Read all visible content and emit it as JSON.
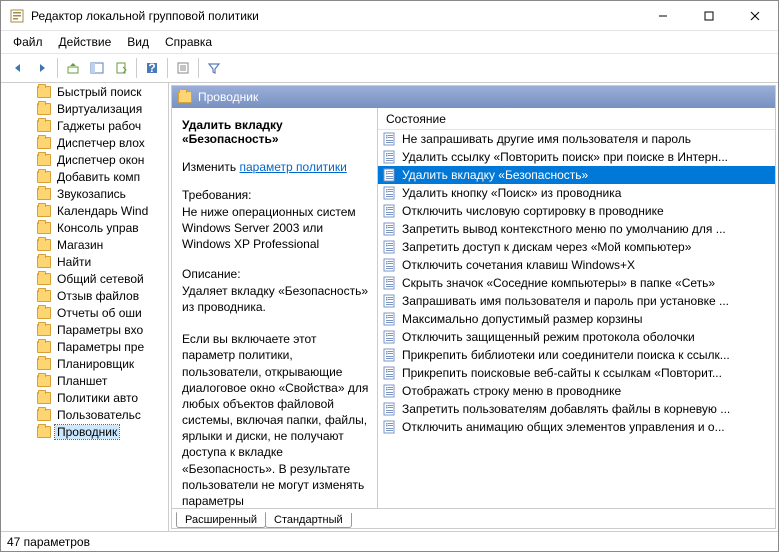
{
  "window": {
    "title": "Редактор локальной групповой политики"
  },
  "menu": {
    "file": "Файл",
    "action": "Действие",
    "view": "Вид",
    "help": "Справка"
  },
  "tree": {
    "items": [
      {
        "label": "Быстрый поиск",
        "sel": false
      },
      {
        "label": "Виртуализация",
        "sel": false
      },
      {
        "label": "Гаджеты рабоч",
        "sel": false
      },
      {
        "label": "Диспетчер влох",
        "sel": false
      },
      {
        "label": "Диспетчер окон",
        "sel": false
      },
      {
        "label": "Добавить комп",
        "sel": false
      },
      {
        "label": "Звукозапись",
        "sel": false
      },
      {
        "label": "Календарь Wind",
        "sel": false
      },
      {
        "label": "Консоль управ",
        "sel": false
      },
      {
        "label": "Магазин",
        "sel": false
      },
      {
        "label": "Найти",
        "sel": false
      },
      {
        "label": "Общий сетевой",
        "sel": false
      },
      {
        "label": "Отзыв файлов",
        "sel": false
      },
      {
        "label": "Отчеты об оши",
        "sel": false
      },
      {
        "label": "Параметры вхо",
        "sel": false
      },
      {
        "label": "Параметры пре",
        "sel": false
      },
      {
        "label": "Планировщик",
        "sel": false
      },
      {
        "label": "Планшет",
        "sel": false
      },
      {
        "label": "Политики авто",
        "sel": false
      },
      {
        "label": "Пользовательс",
        "sel": false
      },
      {
        "label": "Проводник",
        "sel": true
      }
    ]
  },
  "right": {
    "header": "Проводник",
    "policy_title": "Удалить вкладку «Безопасность»",
    "edit_label": "Изменить",
    "edit_link": "параметр политики",
    "req_label": "Требования:",
    "req_text": "Не ниже операционных систем Windows Server 2003 или Windows XP Professional",
    "desc_label": "Описание:",
    "desc_text": "Удаляет вкладку «Безопасность» из проводника.\n\nЕсли вы включаете этот параметр политики, пользователи, открывающие диалоговое окно «Свойства» для любых объектов файловой системы, включая папки, файлы, ярлыки и диски, не получают доступа к вкладке «Безопасность». В результате пользователи не могут изменять параметры",
    "state_header": "Состояние",
    "items": [
      {
        "label": "Не запрашивать другие имя пользователя и пароль",
        "sel": false
      },
      {
        "label": "Удалить ссылку «Повторить поиск» при поиске в Интерн...",
        "sel": false
      },
      {
        "label": "Удалить вкладку «Безопасность»",
        "sel": true
      },
      {
        "label": "Удалить кнопку «Поиск» из проводника",
        "sel": false
      },
      {
        "label": "Отключить числовую сортировку в проводнике",
        "sel": false
      },
      {
        "label": "Запретить вывод контекстного меню по умолчанию для ...",
        "sel": false
      },
      {
        "label": "Запретить доступ к дискам через «Мой компьютер»",
        "sel": false
      },
      {
        "label": "Отключить сочетания клавиш Windows+X",
        "sel": false
      },
      {
        "label": "Скрыть значок «Соседние компьютеры» в папке «Сеть»",
        "sel": false
      },
      {
        "label": "Запрашивать имя пользователя и пароль при установке ...",
        "sel": false
      },
      {
        "label": "Максимально допустимый размер корзины",
        "sel": false
      },
      {
        "label": "Отключить защищенный режим протокола оболочки",
        "sel": false
      },
      {
        "label": "Прикрепить библиотеки или соединители поиска к ссылк...",
        "sel": false
      },
      {
        "label": "Прикрепить поисковые веб-сайты к ссылкам «Повторит...",
        "sel": false
      },
      {
        "label": "Отображать строку меню в проводнике",
        "sel": false
      },
      {
        "label": "Запретить пользователям добавлять файлы в корневую ...",
        "sel": false
      },
      {
        "label": "Отключить анимацию общих элементов управления и о...",
        "sel": false
      }
    ],
    "tabs": {
      "extended": "Расширенный",
      "standard": "Стандартный"
    }
  },
  "status": "47 параметров"
}
